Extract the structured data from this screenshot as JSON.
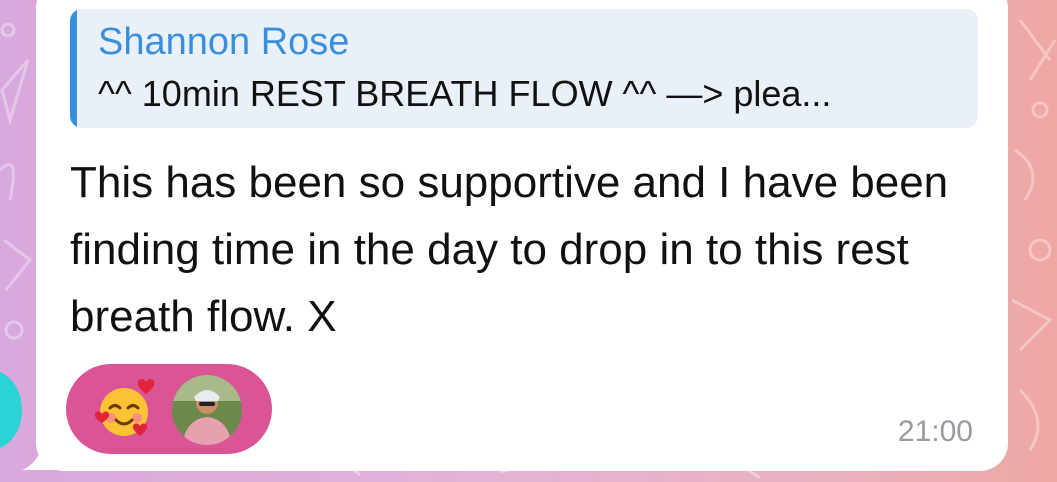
{
  "reply": {
    "author": "Shannon Rose",
    "preview": "^^ 10min REST BREATH FLOW ^^ —> plea..."
  },
  "message": {
    "text": "This has been so supportive and I have been finding time in the day to drop in to this rest breath flow. X",
    "time": "21:00"
  },
  "reactions": {
    "emoji": "smiling-face-with-hearts",
    "reactor": "user-avatar-photo",
    "pill_color": "#d95596"
  },
  "colors": {
    "accent": "#3a8fdc",
    "reply_background": "#e9f0f8",
    "bubble": "#ffffff"
  }
}
